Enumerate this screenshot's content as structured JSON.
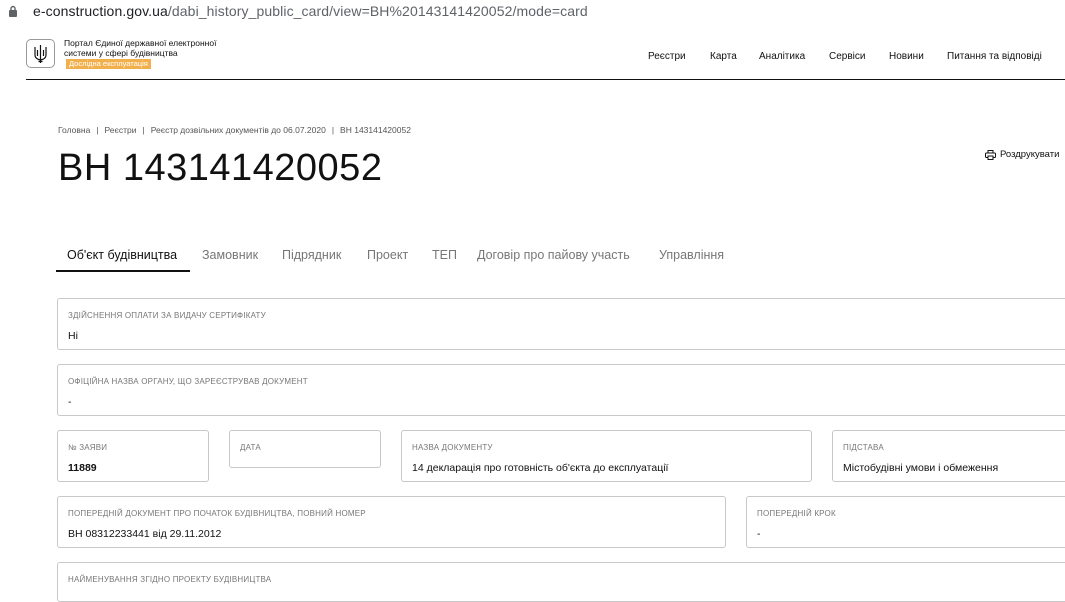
{
  "browser": {
    "url_host": "e-construction.gov.ua",
    "url_path": "/dabi_history_public_card/view=BH%20143141420052/mode=card"
  },
  "header": {
    "portal_title": "Портал Єдиної державної електронної системи у сфері будівництва",
    "beta_badge": "Дослідна експлуатація",
    "nav": [
      "Реєстри",
      "Карта",
      "Аналітика",
      "Сервіси",
      "Новини",
      "Питання та відповіді"
    ]
  },
  "breadcrumb": [
    "Головна",
    "Реєстри",
    "Реєстр дозвільних документів до 06.07.2020",
    "ВН 143141420052"
  ],
  "page": {
    "title": "ВН 143141420052",
    "print_label": "Роздрукувати"
  },
  "tabs": [
    "Об'єкт будівництва",
    "Замовник",
    "Підрядник",
    "Проект",
    "ТЕП",
    "Договір про пайову участь",
    "Управління"
  ],
  "fields": {
    "payment": {
      "label": "Здійснення оплати за видачу сертифікату",
      "value": "Ні"
    },
    "authority": {
      "label": "Офіційна назва органу, що зареєстрував документ",
      "value": "-"
    },
    "app_no": {
      "label": "№ заяви",
      "value": "11889"
    },
    "date": {
      "label": "Дата",
      "value": ""
    },
    "doc_name": {
      "label": "Назва документу",
      "value": "14 декларація про готовність об'єкта до експлуатації"
    },
    "basis": {
      "label": "Підстава",
      "value": "Містобудівні умови і обмеження"
    },
    "prev_doc": {
      "label": "Попередній документ про початок будівництва, повний номер",
      "value": "ВН 08312233441 від 29.11.2012"
    },
    "prev_step": {
      "label": "Попередній крок",
      "value": "-"
    },
    "name_by_project": {
      "label": "Найменування згідно проекту будівництва",
      "value": ""
    }
  },
  "colors": {
    "badge": "#f2b04d",
    "active_tab": "#111111",
    "inactive_tab": "#777777"
  }
}
